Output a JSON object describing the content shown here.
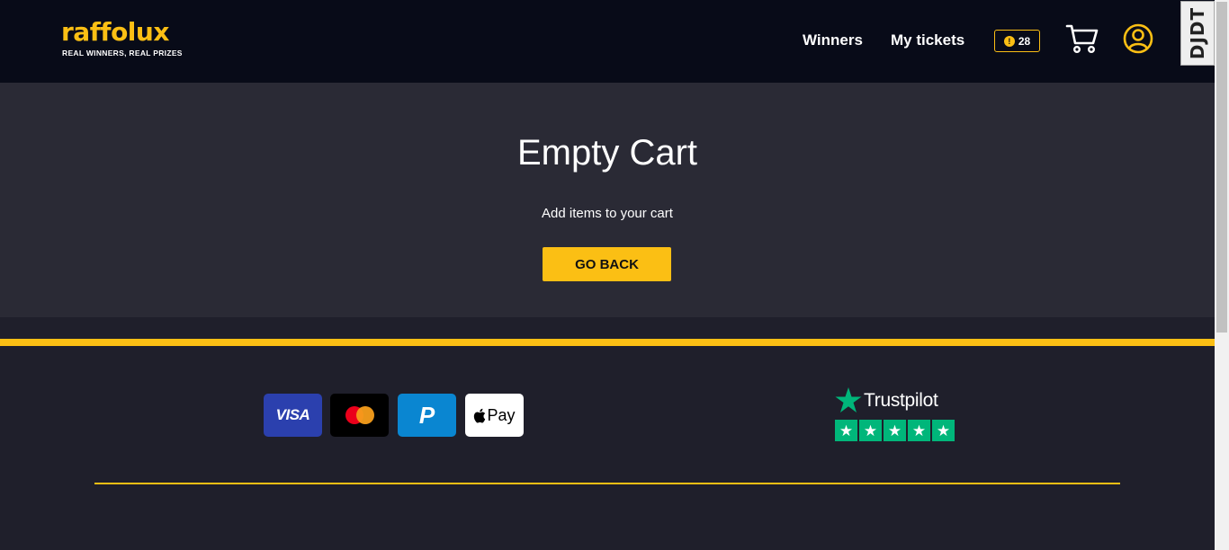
{
  "header": {
    "logo_text": "raffolux",
    "logo_tagline": "REAL WINNERS, REAL PRIZES",
    "nav": {
      "winners": "Winners",
      "my_tickets": "My tickets"
    },
    "coin_count": "28",
    "coin_icon": "coin-icon",
    "cart_icon": "cart-icon",
    "account_icon": "user-circle-icon"
  },
  "debug_toolbar": {
    "label": "DJDT"
  },
  "main": {
    "title": "Empty Cart",
    "subtitle": "Add items to your cart",
    "button_label": "GO BACK"
  },
  "footer": {
    "payments": {
      "visa": "VISA",
      "mastercard": "mastercard-logo",
      "paypal": "P",
      "apple_pay": "Pay"
    },
    "trustpilot": {
      "name": "Trustpilot",
      "rating_stars": 5
    }
  },
  "colors": {
    "accent": "#fbbf14",
    "header_bg": "#080b18",
    "main_bg": "#2a2a35",
    "footer_bg": "#1f1f2b",
    "trustpilot_green": "#00b67a"
  }
}
